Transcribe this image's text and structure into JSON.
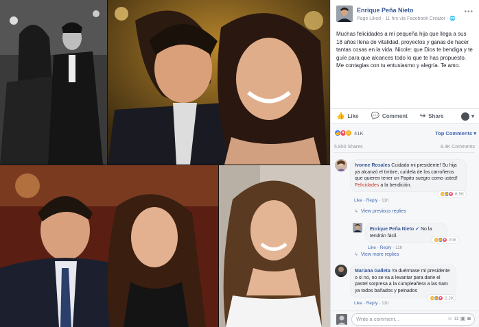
{
  "post": {
    "author": "Enrique Peña Nieto",
    "meta": "Page Liked · 11 hrs via Facebook Creator · ",
    "more_icon": "more-options-icon",
    "text": "Muchas felicidades a mi pequeña hija que llega a sus 18 años llena de vitalidad, proyectos y ganas de hacer tantas cosas en la vida. Nicole: que Dios te bendiga y te guíe para que alcances todo lo que te has propuesto. Me contagias con tu entusiasmo y alegría. Te amo."
  },
  "actions": {
    "like": "Like",
    "comment": "Comment",
    "share": "Share",
    "audience_icon": "chevron-down-icon"
  },
  "reactions": {
    "count": "41K",
    "top_comments": "Top Comments ▾",
    "shares": "5,850 Shares",
    "comments": "8.4K Comments"
  },
  "comments": [
    {
      "author": "Ivonne Rosales",
      "text_before": " Cuidado mi presidente! Su hija ya alcanzó el timbre, cuídela de los carroñeros que quieren tener un Papito suegro como usted! ",
      "highlight": "Felicidades",
      "text_after": " a la bendición.",
      "like": "Like",
      "reply": "Reply",
      "time": "11h",
      "reactions": "6.5K",
      "view_link": "View previous replies"
    },
    {
      "author": "Enrique Peña Nieto",
      "text": " No la tendrán fácil.",
      "like": "Like",
      "reply": "Reply",
      "time": "11h",
      "reactions": "20K",
      "view_link": "View more replies"
    },
    {
      "author": "Mariana Galleta",
      "text": " Ya duérmase mi presidente o si no, no se va a levantar para darle el pastel sorpresa a la cumpleañera a las 6am ya todos bañados y peinados",
      "like": "Like",
      "reply": "Reply",
      "time": "11h",
      "reactions": "2.2K"
    }
  ],
  "write": {
    "placeholder": "Write a comment...",
    "icons": "camera-icon"
  },
  "colors": {
    "link": "#385898",
    "like_blue": "#4080ff",
    "love_red": "#f25268",
    "haha_yellow": "#f7b125"
  }
}
